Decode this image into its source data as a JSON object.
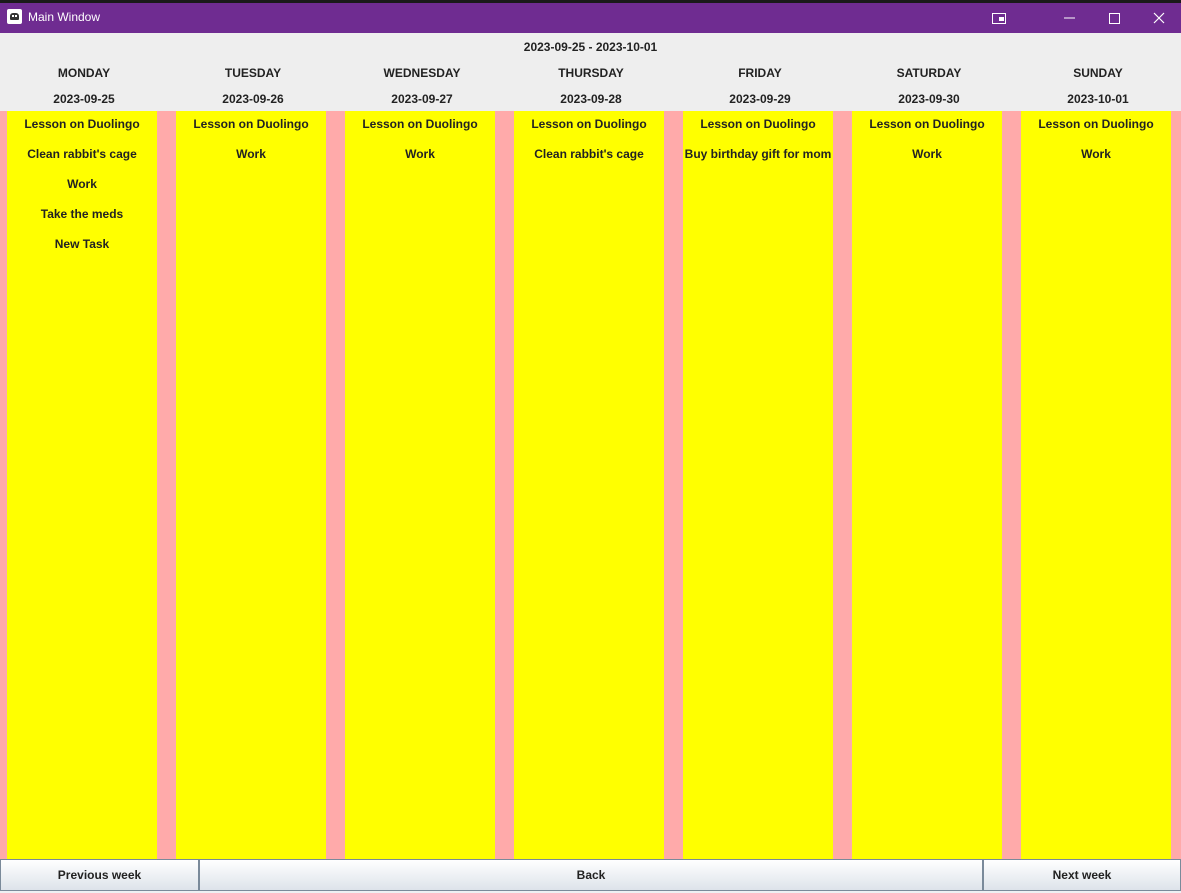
{
  "window": {
    "title": "Main Window",
    "icons": [
      "app-icon",
      "snap-icon",
      "minimize-icon",
      "maximize-icon",
      "close-icon"
    ]
  },
  "week": {
    "range": "2023-09-25 - 2023-10-01"
  },
  "colors": {
    "titlebar": "#6f2c91",
    "column": "#ffff00",
    "gutter": "#ffaaaa",
    "header": "#eeeeee"
  },
  "days": [
    {
      "name": "MONDAY",
      "date": "2023-09-25",
      "tasks": [
        "Lesson on Duolingo",
        "Clean rabbit's cage",
        "Work",
        "Take the meds",
        "New Task"
      ]
    },
    {
      "name": "TUESDAY",
      "date": "2023-09-26",
      "tasks": [
        "Lesson on Duolingo",
        "Work"
      ]
    },
    {
      "name": "WEDNESDAY",
      "date": "2023-09-27",
      "tasks": [
        "Lesson on Duolingo",
        "Work"
      ]
    },
    {
      "name": "THURSDAY",
      "date": "2023-09-28",
      "tasks": [
        "Lesson on Duolingo",
        "Clean rabbit's cage"
      ]
    },
    {
      "name": "FRIDAY",
      "date": "2023-09-29",
      "tasks": [
        "Lesson on Duolingo",
        "Buy birthday gift for mom"
      ]
    },
    {
      "name": "SATURDAY",
      "date": "2023-09-30",
      "tasks": [
        "Lesson on Duolingo",
        "Work"
      ]
    },
    {
      "name": "SUNDAY",
      "date": "2023-10-01",
      "tasks": [
        "Lesson on Duolingo",
        "Work"
      ]
    }
  ],
  "footer": {
    "previous_label": "Previous week",
    "back_label": "Back",
    "next_label": "Next week"
  }
}
